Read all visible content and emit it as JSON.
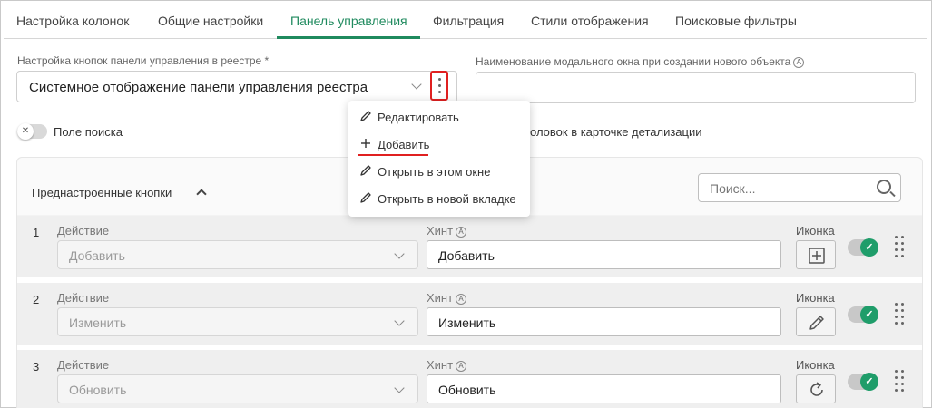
{
  "tabs": [
    {
      "label": "Настройка колонок",
      "active": false
    },
    {
      "label": "Общие настройки",
      "active": false
    },
    {
      "label": "Панель управления",
      "active": true
    },
    {
      "label": "Фильтрация",
      "active": false
    },
    {
      "label": "Стили отображения",
      "active": false
    },
    {
      "label": "Поисковые фильтры",
      "active": false
    }
  ],
  "registry_buttons": {
    "label": "Настройка кнопок панели управления в реестре *",
    "value": "Системное отображение панели управления реестра"
  },
  "modal_name": {
    "label": "Наименование модального окна при создании нового объекта",
    "value": ""
  },
  "search_field_toggle": {
    "label": "Поле поиска",
    "on": false
  },
  "detail_header_toggle": {
    "label_visible": "оловок в карточке детализации"
  },
  "menu": {
    "items": [
      {
        "label": "Редактировать",
        "icon": "pencil-icon"
      },
      {
        "label": "Добавить",
        "icon": "plus-icon"
      },
      {
        "label": "Открыть в этом окне",
        "icon": "pencil-icon"
      },
      {
        "label": "Открыть в новой вкладке",
        "icon": "pencil-icon"
      }
    ]
  },
  "preset_panel": {
    "title": "Преднастроенные кнопки",
    "search_placeholder": "Поиск...",
    "action_label": "Действие",
    "hint_label": "Хинт",
    "icon_label": "Иконка",
    "rows": [
      {
        "num": "1",
        "action": "Добавить",
        "hint": "Добавить",
        "icon": "plus-square-icon",
        "enabled": true
      },
      {
        "num": "2",
        "action": "Изменить",
        "hint": "Изменить",
        "icon": "pencil-icon",
        "enabled": true
      },
      {
        "num": "3",
        "action": "Обновить",
        "hint": "Обновить",
        "icon": "refresh-icon",
        "enabled": true
      }
    ]
  },
  "colors": {
    "accent": "#1f8a5e",
    "highlight": "#e02020",
    "toggle_on": "#1f9d6a"
  }
}
